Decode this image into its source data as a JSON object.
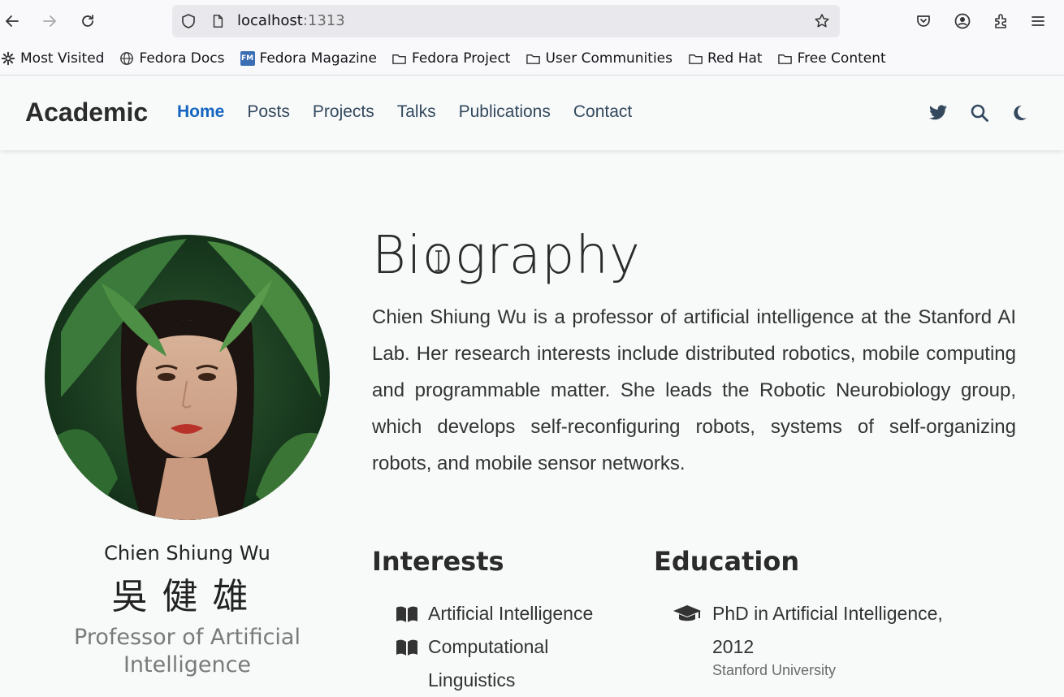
{
  "browser": {
    "url_host": "localhost",
    "url_port": ":1313",
    "bookmarks": [
      {
        "label": "Most Visited",
        "icon": "gear-icon"
      },
      {
        "label": "Fedora Docs",
        "icon": "globe-icon"
      },
      {
        "label": "Fedora Magazine",
        "icon": "fedora-magazine-icon"
      },
      {
        "label": "Fedora Project",
        "icon": "folder-icon"
      },
      {
        "label": "User Communities",
        "icon": "folder-icon"
      },
      {
        "label": "Red Hat",
        "icon": "folder-icon"
      },
      {
        "label": "Free Content",
        "icon": "folder-icon"
      }
    ],
    "fm_badge": "FM"
  },
  "site": {
    "brand": "Academic",
    "nav": [
      {
        "label": "Home",
        "active": true
      },
      {
        "label": "Posts"
      },
      {
        "label": "Projects"
      },
      {
        "label": "Talks"
      },
      {
        "label": "Publications"
      },
      {
        "label": "Contact"
      }
    ]
  },
  "profile": {
    "name": "Chien Shiung Wu",
    "name_cjk": "吳健雄",
    "role": "Professor of Artificial Intelligence"
  },
  "biography": {
    "heading": "Biography",
    "text": "Chien Shiung Wu is a professor of artificial intelligence at the Stanford AI Lab. Her research interests include distributed robotics, mobile computing and programmable matter. She leads the Robotic Neurobiology group, which develops self-reconfiguring robots, systems of self-organizing robots, and mobile sensor networks."
  },
  "interests": {
    "heading": "Interests",
    "items": [
      "Artificial Intelligence",
      "Computational Linguistics"
    ]
  },
  "education": {
    "heading": "Education",
    "items": [
      {
        "course": "PhD in Artificial Intelligence, 2012",
        "institution": "Stanford University"
      }
    ]
  },
  "colors": {
    "accent": "#1565c0",
    "nav_text": "#34495e",
    "page_bg": "#f7faf8"
  }
}
